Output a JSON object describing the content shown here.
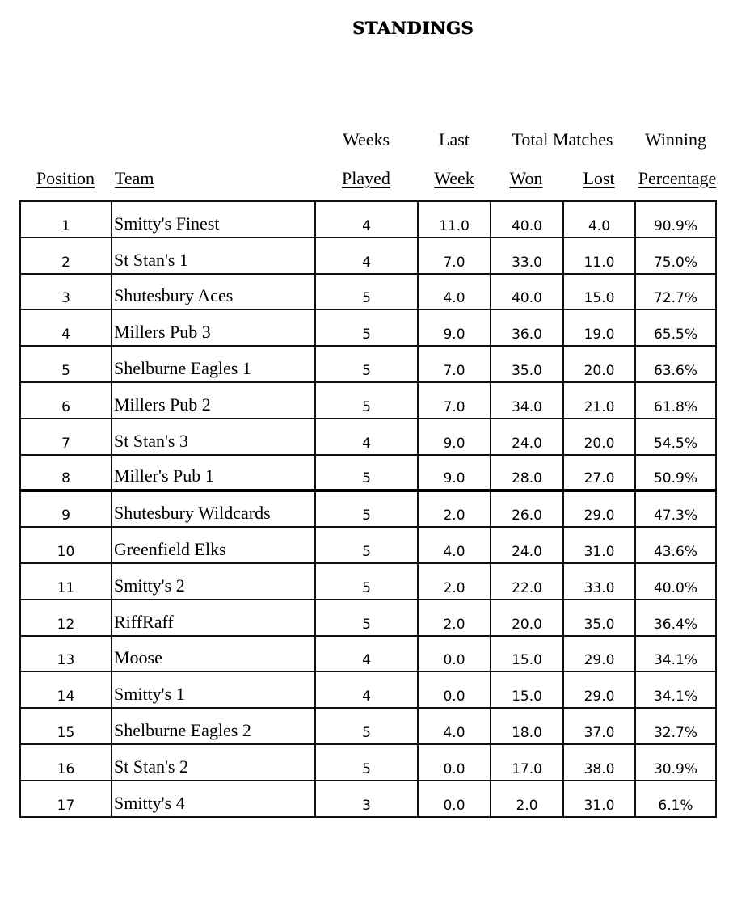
{
  "title": "STANDINGS",
  "headers": {
    "position": "Position",
    "team": "Team",
    "weeks_top": "Weeks",
    "weeks_bottom": "Played",
    "last_top": "Last",
    "last_bottom": "Week",
    "total_matches": "Total Matches",
    "won": "Won",
    "lost": "Lost",
    "winning_top": "Winning",
    "winning_bottom": "Percentage"
  },
  "rows": [
    {
      "position": "1",
      "team": "Smitty's Finest",
      "weeks_played": "4",
      "last_week": "11.0",
      "won": "40.0",
      "lost": "4.0",
      "pct": "90.9%"
    },
    {
      "position": "2",
      "team": "St Stan's 1",
      "weeks_played": "4",
      "last_week": "7.0",
      "won": "33.0",
      "lost": "11.0",
      "pct": "75.0%"
    },
    {
      "position": "3",
      "team": "Shutesbury Aces",
      "weeks_played": "5",
      "last_week": "4.0",
      "won": "40.0",
      "lost": "15.0",
      "pct": "72.7%"
    },
    {
      "position": "4",
      "team": "Millers Pub 3",
      "weeks_played": "5",
      "last_week": "9.0",
      "won": "36.0",
      "lost": "19.0",
      "pct": "65.5%"
    },
    {
      "position": "5",
      "team": "Shelburne Eagles 1",
      "weeks_played": "5",
      "last_week": "7.0",
      "won": "35.0",
      "lost": "20.0",
      "pct": "63.6%"
    },
    {
      "position": "6",
      "team": "Millers Pub 2",
      "weeks_played": "5",
      "last_week": "7.0",
      "won": "34.0",
      "lost": "21.0",
      "pct": "61.8%"
    },
    {
      "position": "7",
      "team": "St Stan's 3",
      "weeks_played": "4",
      "last_week": "9.0",
      "won": "24.0",
      "lost": "20.0",
      "pct": "54.5%"
    },
    {
      "position": "8",
      "team": "Miller's Pub 1",
      "weeks_played": "5",
      "last_week": "9.0",
      "won": "28.0",
      "lost": "27.0",
      "pct": "50.9%"
    },
    {
      "position": "9",
      "team": "Shutesbury Wildcards",
      "weeks_played": "5",
      "last_week": "2.0",
      "won": "26.0",
      "lost": "29.0",
      "pct": "47.3%"
    },
    {
      "position": "10",
      "team": "Greenfield Elks",
      "weeks_played": "5",
      "last_week": "4.0",
      "won": "24.0",
      "lost": "31.0",
      "pct": "43.6%"
    },
    {
      "position": "11",
      "team": "Smitty's 2",
      "weeks_played": "5",
      "last_week": "2.0",
      "won": "22.0",
      "lost": "33.0",
      "pct": "40.0%"
    },
    {
      "position": "12",
      "team": "RiffRaff",
      "weeks_played": "5",
      "last_week": "2.0",
      "won": "20.0",
      "lost": "35.0",
      "pct": "36.4%"
    },
    {
      "position": "13",
      "team": "Moose",
      "weeks_played": "4",
      "last_week": "0.0",
      "won": "15.0",
      "lost": "29.0",
      "pct": "34.1%"
    },
    {
      "position": "14",
      "team": "Smitty's 1",
      "weeks_played": "4",
      "last_week": "0.0",
      "won": "15.0",
      "lost": "29.0",
      "pct": "34.1%"
    },
    {
      "position": "15",
      "team": "Shelburne Eagles 2",
      "weeks_played": "5",
      "last_week": "4.0",
      "won": "18.0",
      "lost": "37.0",
      "pct": "32.7%"
    },
    {
      "position": "16",
      "team": "St Stan's 2",
      "weeks_played": "5",
      "last_week": "0.0",
      "won": "17.0",
      "lost": "38.0",
      "pct": "30.9%"
    },
    {
      "position": "17",
      "team": "Smitty's 4",
      "weeks_played": "3",
      "last_week": "0.0",
      "won": "2.0",
      "lost": "31.0",
      "pct": "6.1%"
    }
  ],
  "cutoff_after_position": "8"
}
